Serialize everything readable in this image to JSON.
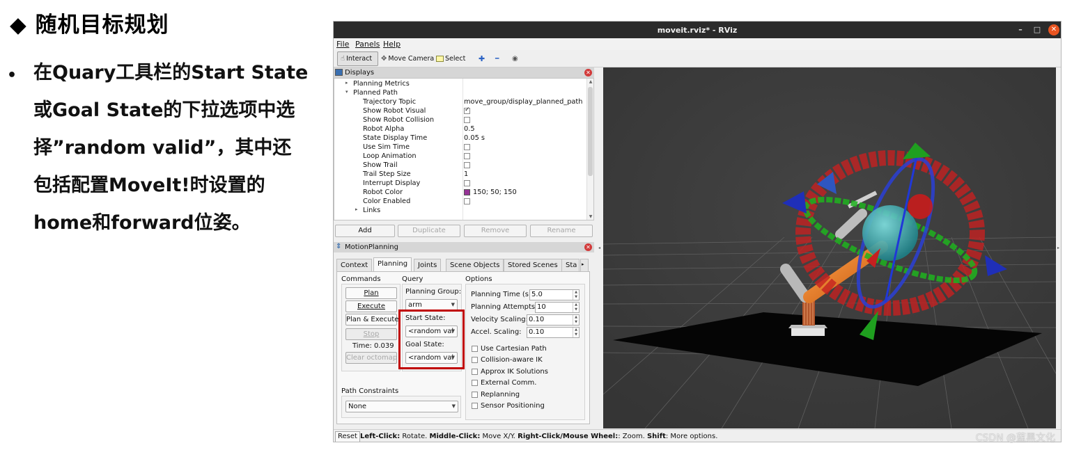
{
  "slide": {
    "title": "◆ 随机目标规划",
    "bullet": "•",
    "lines": [
      "在Quary工具栏的Start State",
      "或Goal State的下拉选项中选",
      "择”random valid”，其中还",
      "包括配置MoveIt!时设置的",
      "home和forward位姿。"
    ]
  },
  "window": {
    "title": "moveit.rviz* - RViz",
    "minimize": "–",
    "maximize": "□",
    "close": "✕"
  },
  "menu": [
    "File",
    "Panels",
    "Help"
  ],
  "toolbar": {
    "interact": "Interact",
    "move_camera": "Move Camera",
    "select": "Select",
    "add_icon": "✚",
    "remove_icon": "━",
    "eye_icon": "◉"
  },
  "displays": {
    "title": "Displays",
    "close": "✕",
    "rows": [
      {
        "name": "Planning Metrics",
        "value": "",
        "indent": 1,
        "arrow": "▸"
      },
      {
        "name": "Planned Path",
        "value": "",
        "indent": 1,
        "arrow": "▾"
      },
      {
        "name": "Trajectory Topic",
        "value": "move_group/display_planned_path",
        "indent": 2
      },
      {
        "name": "Show Robot Visual",
        "value": "",
        "indent": 2,
        "check": true
      },
      {
        "name": "Show Robot Collision",
        "value": "",
        "indent": 2,
        "check": false
      },
      {
        "name": "Robot Alpha",
        "value": "0.5",
        "indent": 2
      },
      {
        "name": "State Display Time",
        "value": "0.05 s",
        "indent": 2
      },
      {
        "name": "Use Sim Time",
        "value": "",
        "indent": 2,
        "check": false
      },
      {
        "name": "Loop Animation",
        "value": "",
        "indent": 2,
        "check": false
      },
      {
        "name": "Show Trail",
        "value": "",
        "indent": 2,
        "check": false
      },
      {
        "name": "Trail Step Size",
        "value": "1",
        "indent": 2
      },
      {
        "name": "Interrupt Display",
        "value": "",
        "indent": 2,
        "check": false
      },
      {
        "name": "Robot Color",
        "value": "150; 50; 150",
        "indent": 2,
        "swatch": "#963296"
      },
      {
        "name": "Color Enabled",
        "value": "",
        "indent": 2,
        "check": false
      },
      {
        "name": "Links",
        "value": "",
        "indent": 2,
        "arrow": "▸"
      }
    ],
    "buttons": {
      "add": "Add",
      "duplicate": "Duplicate",
      "remove": "Remove",
      "rename": "Rename"
    }
  },
  "motion_planning": {
    "title": "MotionPlanning",
    "close": "✕",
    "tabs": [
      "Context",
      "Planning",
      "Joints",
      "Scene Objects",
      "Stored Scenes",
      "Sta"
    ],
    "active_tab": "Planning",
    "commands": {
      "header": "Commands",
      "plan": "Plan",
      "execute": "Execute",
      "plan_execute": "Plan & Execute",
      "stop": "Stop",
      "time": "Time: 0.039",
      "clear_octomap": "Clear octomap"
    },
    "query": {
      "header": "Query",
      "planning_group_label": "Planning Group:",
      "planning_group_value": "arm",
      "start_state_label": "Start State:",
      "start_state_value": "<random val",
      "goal_state_label": "Goal State:",
      "goal_state_value": "<random val"
    },
    "options": {
      "header": "Options",
      "planning_time_label": "Planning Time (s):",
      "planning_time_value": "5.0",
      "planning_attempts_label": "Planning Attempts:",
      "planning_attempts_value": "10",
      "velocity_scaling_label": "Velocity Scaling:",
      "velocity_scaling_value": "0.10",
      "accel_scaling_label": "Accel. Scaling:",
      "accel_scaling_value": "0.10",
      "checkboxes": [
        "Use Cartesian Path",
        "Collision-aware IK",
        "Approx IK Solutions",
        "External Comm.",
        "Replanning",
        "Sensor Positioning"
      ]
    },
    "path_constraints": {
      "label": "Path Constraints",
      "value": "None"
    }
  },
  "statusbar": {
    "reset": "Reset",
    "left_click_key": "Left-Click:",
    "left_click_desc": " Rotate. ",
    "middle_click_key": "Middle-Click:",
    "middle_click_desc": " Move X/Y. ",
    "right_click_key": "Right-Click/Mouse Wheel:",
    "right_click_desc": ": Zoom. ",
    "shift_key": "Shift",
    "shift_desc": ": More options."
  },
  "watermark": "CSDN @蓝黑文化",
  "colors": {
    "highlight_box": "#c00000",
    "view_background": "#3a3a3a",
    "title_bar": "#2b2b2b",
    "close_button": "#e95420"
  }
}
